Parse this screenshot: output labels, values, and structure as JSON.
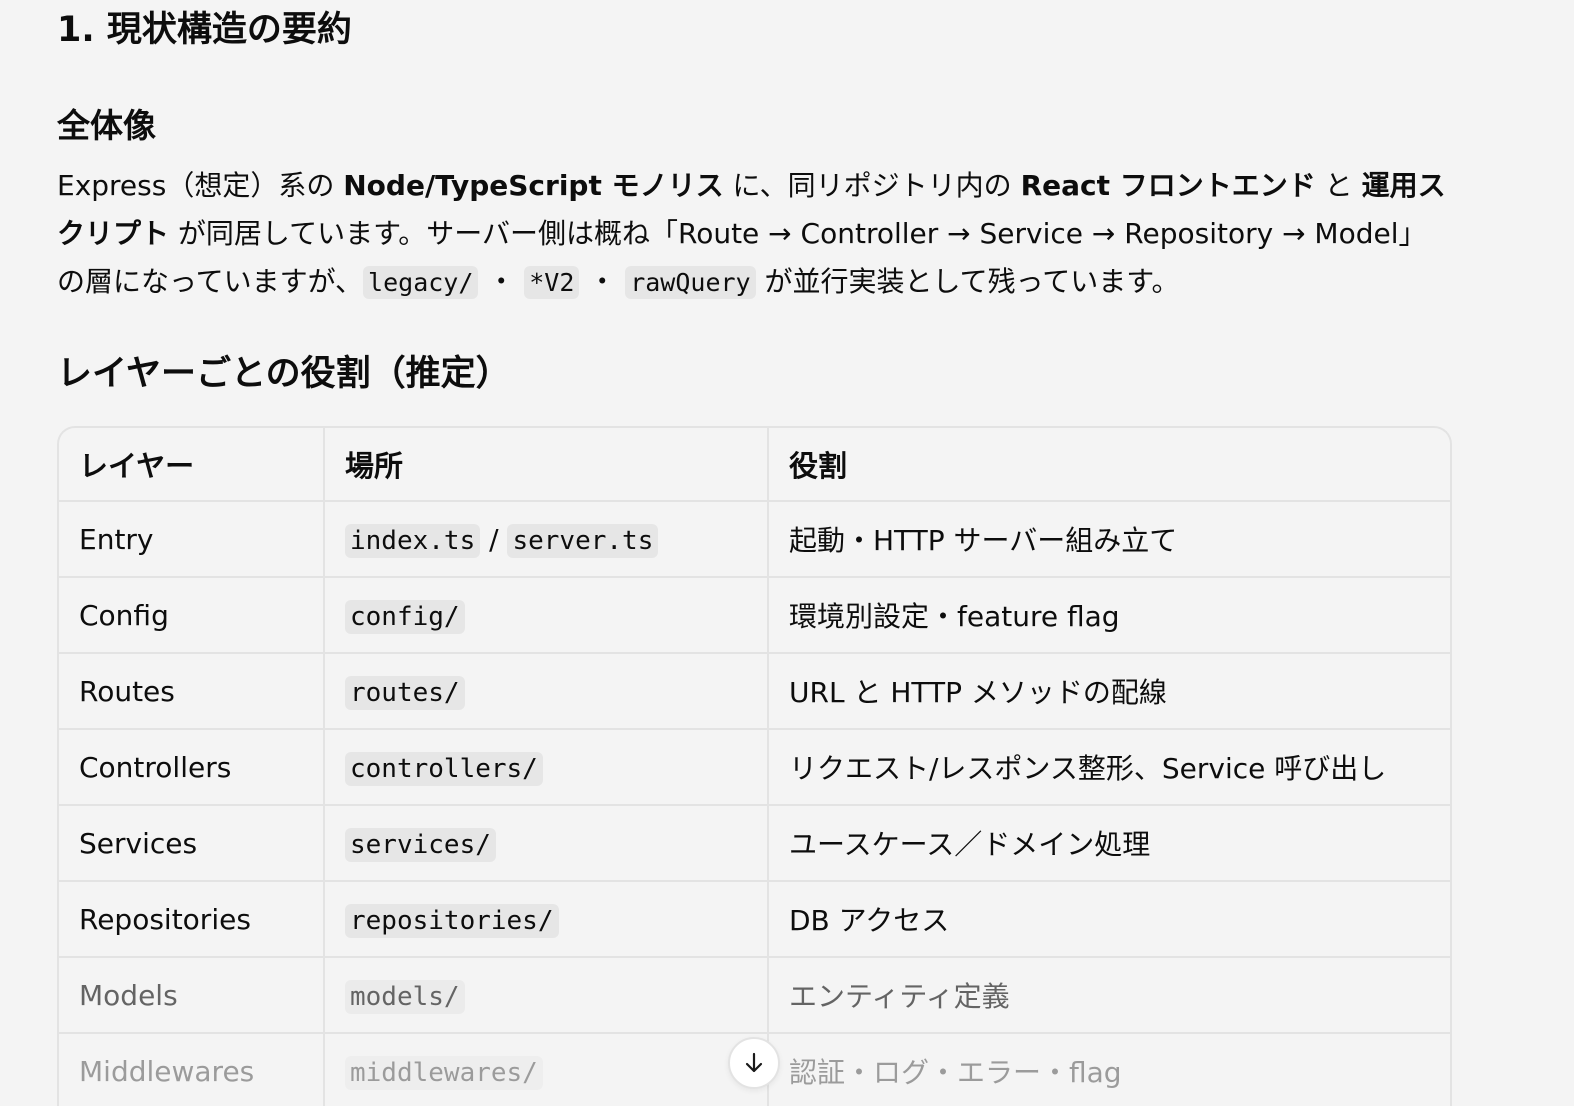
{
  "section_title": "1. 現状構造の要約",
  "overview": {
    "heading": "全体像",
    "p1": "Express（想定）系の ",
    "b1": "Node/TypeScript モノリス",
    "p2": " に、同リポジトリ内の ",
    "b2": "React フロントエンド",
    "p3": " と ",
    "b3": "運用スクリプト",
    "p4": " が同居しています。サーバー側は概ね「Route → Controller → Service → Repository → Model」の層になっていますが、",
    "code1": "legacy/",
    "sep1": " ・ ",
    "code2": "*V2",
    "sep2": " ・ ",
    "code3": "rawQuery",
    "p5": " が並行実装として残っています。"
  },
  "layers": {
    "heading": "レイヤーごとの役割（推定）",
    "headers": [
      "レイヤー",
      "場所",
      "役割"
    ],
    "rows": [
      {
        "layer": "Entry",
        "loc1": "index.ts",
        "loc_sep": " / ",
        "loc2": "server.ts",
        "role": "起動・HTTP サーバー組み立て"
      },
      {
        "layer": "Config",
        "loc1": "config/",
        "role": "環境別設定・feature flag"
      },
      {
        "layer": "Routes",
        "loc1": "routes/",
        "role": "URL と HTTP メソッドの配線"
      },
      {
        "layer": "Controllers",
        "loc1": "controllers/",
        "role": "リクエスト/レスポンス整形、Service 呼び出し"
      },
      {
        "layer": "Services",
        "loc1": "services/",
        "role": "ユースケース／ドメイン処理"
      },
      {
        "layer": "Repositories",
        "loc1": "repositories/",
        "role": "DB アクセス"
      },
      {
        "layer": "Models",
        "loc1": "models/",
        "role": "エンティティ定義"
      },
      {
        "layer": "Middlewares",
        "loc1": "middlewares/",
        "role": "認証・ログ・エラー・flag"
      }
    ]
  },
  "scroll_button": {
    "icon": "arrow-down-icon"
  }
}
